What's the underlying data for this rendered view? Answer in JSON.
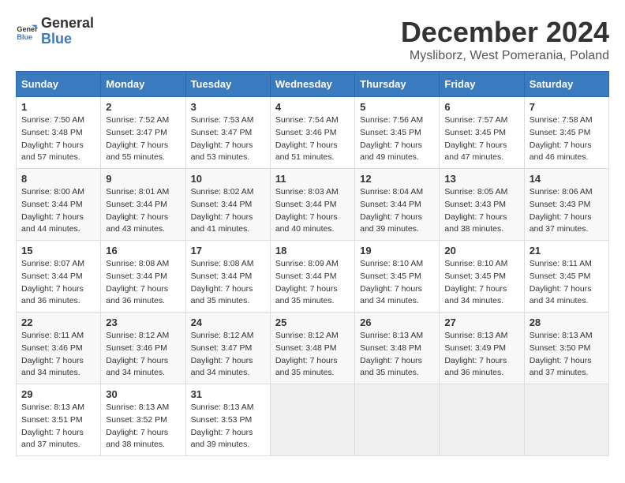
{
  "logo": {
    "line1": "General",
    "line2": "Blue"
  },
  "title": "December 2024",
  "subtitle": "Mysliborz, West Pomerania, Poland",
  "weekdays": [
    "Sunday",
    "Monday",
    "Tuesday",
    "Wednesday",
    "Thursday",
    "Friday",
    "Saturday"
  ],
  "weeks": [
    [
      {
        "day": "1",
        "sunrise": "7:50 AM",
        "sunset": "3:48 PM",
        "daylight": "7 hours and 57 minutes."
      },
      {
        "day": "2",
        "sunrise": "7:52 AM",
        "sunset": "3:47 PM",
        "daylight": "7 hours and 55 minutes."
      },
      {
        "day": "3",
        "sunrise": "7:53 AM",
        "sunset": "3:47 PM",
        "daylight": "7 hours and 53 minutes."
      },
      {
        "day": "4",
        "sunrise": "7:54 AM",
        "sunset": "3:46 PM",
        "daylight": "7 hours and 51 minutes."
      },
      {
        "day": "5",
        "sunrise": "7:56 AM",
        "sunset": "3:45 PM",
        "daylight": "7 hours and 49 minutes."
      },
      {
        "day": "6",
        "sunrise": "7:57 AM",
        "sunset": "3:45 PM",
        "daylight": "7 hours and 47 minutes."
      },
      {
        "day": "7",
        "sunrise": "7:58 AM",
        "sunset": "3:45 PM",
        "daylight": "7 hours and 46 minutes."
      }
    ],
    [
      {
        "day": "8",
        "sunrise": "8:00 AM",
        "sunset": "3:44 PM",
        "daylight": "7 hours and 44 minutes."
      },
      {
        "day": "9",
        "sunrise": "8:01 AM",
        "sunset": "3:44 PM",
        "daylight": "7 hours and 43 minutes."
      },
      {
        "day": "10",
        "sunrise": "8:02 AM",
        "sunset": "3:44 PM",
        "daylight": "7 hours and 41 minutes."
      },
      {
        "day": "11",
        "sunrise": "8:03 AM",
        "sunset": "3:44 PM",
        "daylight": "7 hours and 40 minutes."
      },
      {
        "day": "12",
        "sunrise": "8:04 AM",
        "sunset": "3:44 PM",
        "daylight": "7 hours and 39 minutes."
      },
      {
        "day": "13",
        "sunrise": "8:05 AM",
        "sunset": "3:43 PM",
        "daylight": "7 hours and 38 minutes."
      },
      {
        "day": "14",
        "sunrise": "8:06 AM",
        "sunset": "3:43 PM",
        "daylight": "7 hours and 37 minutes."
      }
    ],
    [
      {
        "day": "15",
        "sunrise": "8:07 AM",
        "sunset": "3:44 PM",
        "daylight": "7 hours and 36 minutes."
      },
      {
        "day": "16",
        "sunrise": "8:08 AM",
        "sunset": "3:44 PM",
        "daylight": "7 hours and 36 minutes."
      },
      {
        "day": "17",
        "sunrise": "8:08 AM",
        "sunset": "3:44 PM",
        "daylight": "7 hours and 35 minutes."
      },
      {
        "day": "18",
        "sunrise": "8:09 AM",
        "sunset": "3:44 PM",
        "daylight": "7 hours and 35 minutes."
      },
      {
        "day": "19",
        "sunrise": "8:10 AM",
        "sunset": "3:45 PM",
        "daylight": "7 hours and 34 minutes."
      },
      {
        "day": "20",
        "sunrise": "8:10 AM",
        "sunset": "3:45 PM",
        "daylight": "7 hours and 34 minutes."
      },
      {
        "day": "21",
        "sunrise": "8:11 AM",
        "sunset": "3:45 PM",
        "daylight": "7 hours and 34 minutes."
      }
    ],
    [
      {
        "day": "22",
        "sunrise": "8:11 AM",
        "sunset": "3:46 PM",
        "daylight": "7 hours and 34 minutes."
      },
      {
        "day": "23",
        "sunrise": "8:12 AM",
        "sunset": "3:46 PM",
        "daylight": "7 hours and 34 minutes."
      },
      {
        "day": "24",
        "sunrise": "8:12 AM",
        "sunset": "3:47 PM",
        "daylight": "7 hours and 34 minutes."
      },
      {
        "day": "25",
        "sunrise": "8:12 AM",
        "sunset": "3:48 PM",
        "daylight": "7 hours and 35 minutes."
      },
      {
        "day": "26",
        "sunrise": "8:13 AM",
        "sunset": "3:48 PM",
        "daylight": "7 hours and 35 minutes."
      },
      {
        "day": "27",
        "sunrise": "8:13 AM",
        "sunset": "3:49 PM",
        "daylight": "7 hours and 36 minutes."
      },
      {
        "day": "28",
        "sunrise": "8:13 AM",
        "sunset": "3:50 PM",
        "daylight": "7 hours and 37 minutes."
      }
    ],
    [
      {
        "day": "29",
        "sunrise": "8:13 AM",
        "sunset": "3:51 PM",
        "daylight": "7 hours and 37 minutes."
      },
      {
        "day": "30",
        "sunrise": "8:13 AM",
        "sunset": "3:52 PM",
        "daylight": "7 hours and 38 minutes."
      },
      {
        "day": "31",
        "sunrise": "8:13 AM",
        "sunset": "3:53 PM",
        "daylight": "7 hours and 39 minutes."
      },
      null,
      null,
      null,
      null
    ]
  ]
}
